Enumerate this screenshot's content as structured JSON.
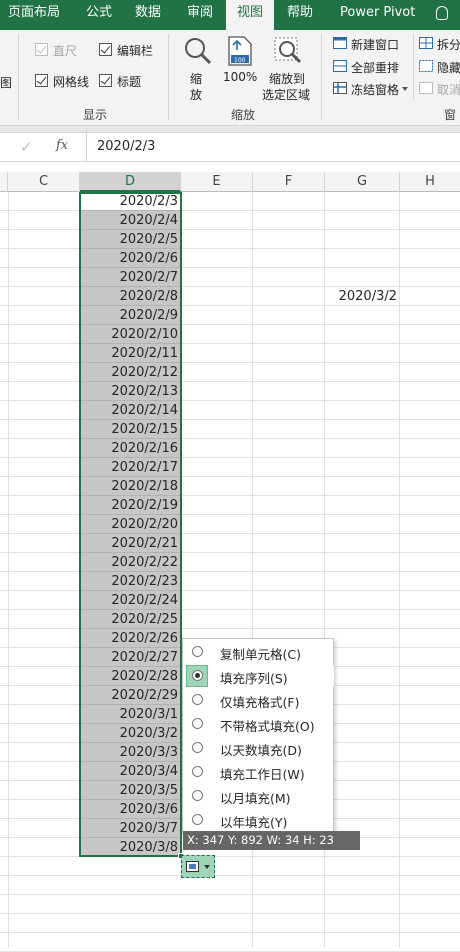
{
  "tabs": [
    {
      "label": "页面布局"
    },
    {
      "label": "公式"
    },
    {
      "label": "数据"
    },
    {
      "label": "审阅"
    },
    {
      "label": "视图",
      "active": true
    },
    {
      "label": "帮助"
    },
    {
      "label": "Power Pivot"
    }
  ],
  "ribbon": {
    "partial_left": "图",
    "show_group": {
      "label": "显示",
      "ruler": "直尺",
      "formula_bar": "编辑栏",
      "gridlines": "网格线",
      "headings": "标题"
    },
    "zoom_group": {
      "label": "缩放",
      "zoom": "缩\n放",
      "zoom_line1": "缩",
      "zoom_line2": "放",
      "hundred": "100%",
      "zoom_sel_line1": "缩放到",
      "zoom_sel_line2": "选定区域"
    },
    "window_group": {
      "label": "窗口",
      "label_partial": "窗",
      "new_window": "新建窗口",
      "arrange_all": "全部重排",
      "freeze_panes": "冻结窗格",
      "split": "拆分",
      "hide": "隐藏",
      "unhide": "取消"
    }
  },
  "formula_bar": {
    "value": "2020/2/3"
  },
  "columns": [
    "C",
    "D",
    "E",
    "F",
    "G",
    "H"
  ],
  "cells_d": [
    "2020/2/3",
    "2020/2/4",
    "2020/2/5",
    "2020/2/6",
    "2020/2/7",
    "2020/2/8",
    "2020/2/9",
    "2020/2/10",
    "2020/2/11",
    "2020/2/12",
    "2020/2/13",
    "2020/2/14",
    "2020/2/15",
    "2020/2/16",
    "2020/2/17",
    "2020/2/18",
    "2020/2/19",
    "2020/2/20",
    "2020/2/21",
    "2020/2/22",
    "2020/2/23",
    "2020/2/24",
    "2020/2/25",
    "2020/2/26",
    "2020/2/27",
    "2020/2/28",
    "2020/2/29",
    "2020/3/1",
    "2020/3/2",
    "2020/3/3",
    "2020/3/4",
    "2020/3/5",
    "2020/3/6",
    "2020/3/7",
    "2020/3/8"
  ],
  "cell_g": "2020/3/2",
  "autofill_menu": [
    {
      "label": "复制单元格(C)",
      "checked": false
    },
    {
      "label": "填充序列(S)",
      "checked": true
    },
    {
      "label": "仅填充格式(F)",
      "checked": false
    },
    {
      "label": "不带格式填充(O)",
      "checked": false
    },
    {
      "label": "以天数填充(D)",
      "checked": false
    },
    {
      "label": "填充工作日(W)",
      "checked": false
    },
    {
      "label": "以月填充(M)",
      "checked": false
    },
    {
      "label": "以年填充(Y)",
      "checked": false
    }
  ],
  "tooltip": "X: 347 Y: 892 W: 34 H: 23",
  "colors": {
    "accent": "#217346",
    "selection_fill": "#c6c6c6",
    "checked_item": "#9fd5b7"
  }
}
